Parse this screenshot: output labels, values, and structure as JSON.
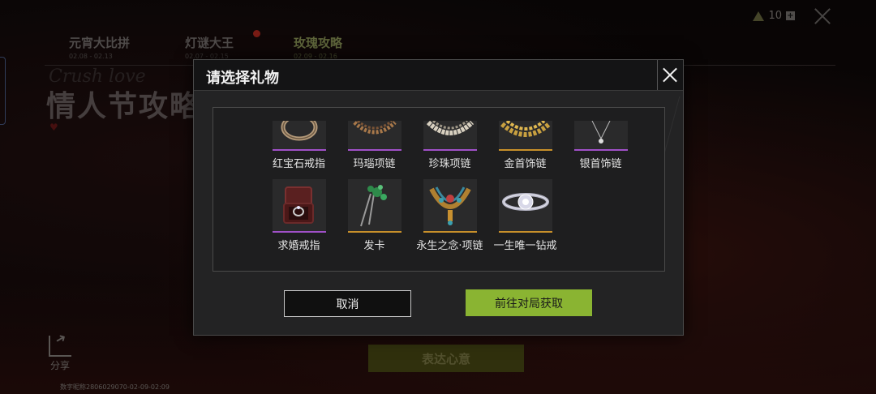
{
  "background": {
    "tabs": [
      {
        "title": "元宵大比拼",
        "dates": "02.08 - 02.13"
      },
      {
        "title": "灯谜大王",
        "dates": "02.07 - 02.15"
      },
      {
        "title": "玫瑰攻略",
        "dates": "02.09 - 02.16"
      }
    ],
    "currency_count": "10",
    "script_title": "Crush love",
    "big_title": "情人节攻略",
    "share_label": "分享",
    "uid_text": "数字昵称2806029070-02-09-02:09",
    "express_button": "表达心意"
  },
  "modal": {
    "title": "请选择礼物",
    "items": [
      {
        "label": "红宝石戒指",
        "rarity": "purple",
        "icon": "ring-icon"
      },
      {
        "label": "玛瑙项链",
        "rarity": "purple",
        "icon": "necklace-icon"
      },
      {
        "label": "珍珠项链",
        "rarity": "purple",
        "icon": "necklace-icon"
      },
      {
        "label": "金首饰链",
        "rarity": "gold",
        "icon": "chain-icon"
      },
      {
        "label": "银首饰链",
        "rarity": "purple",
        "icon": "pendant-icon"
      },
      {
        "label": "求婚戒指",
        "rarity": "purple",
        "icon": "ring-box-icon"
      },
      {
        "label": "发卡",
        "rarity": "gold",
        "icon": "hairpin-icon"
      },
      {
        "label": "永生之念·项链",
        "rarity": "gold",
        "icon": "jeweled-necklace-icon"
      },
      {
        "label": "一生唯一钻戒",
        "rarity": "gold",
        "icon": "diamond-ring-icon"
      }
    ],
    "cancel_label": "取消",
    "go_label": "前往对局获取"
  },
  "colors": {
    "purple_rarity": "#a050c8",
    "gold_rarity": "#c8902a",
    "primary_button": "#8ab432"
  }
}
